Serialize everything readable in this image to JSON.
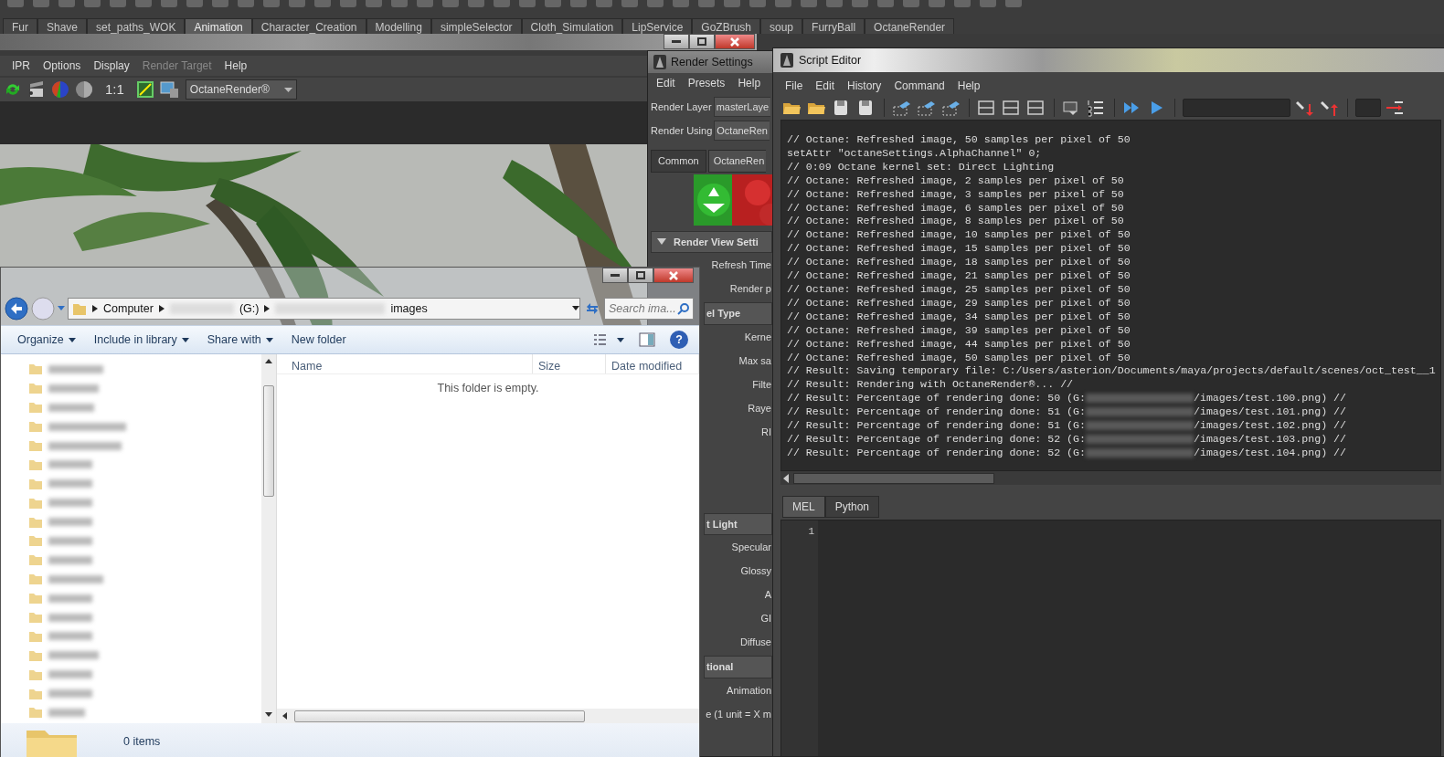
{
  "shelf_tabs": [
    {
      "label": "Fur",
      "selected": false
    },
    {
      "label": "Shave",
      "selected": false
    },
    {
      "label": "set_paths_WOK",
      "selected": false
    },
    {
      "label": "Animation",
      "selected": true
    },
    {
      "label": "Character_Creation",
      "selected": false
    },
    {
      "label": "Modelling",
      "selected": false
    },
    {
      "label": "simpleSelector",
      "selected": false
    },
    {
      "label": "Cloth_Simulation",
      "selected": false
    },
    {
      "label": "LipService",
      "selected": false
    },
    {
      "label": "GoZBrush",
      "selected": false
    },
    {
      "label": "soup",
      "selected": false
    },
    {
      "label": "FurryBall",
      "selected": false
    },
    {
      "label": "OctaneRender",
      "selected": false
    }
  ],
  "render_view": {
    "menu": [
      {
        "label": "IPR",
        "disabled": false
      },
      {
        "label": "Options",
        "disabled": false
      },
      {
        "label": "Display",
        "disabled": false
      },
      {
        "label": "Render Target",
        "disabled": true
      },
      {
        "label": "Help",
        "disabled": false
      }
    ],
    "ratio": "1:1",
    "renderer": "OctaneRender®"
  },
  "render_settings": {
    "title": "Render Settings",
    "menu": [
      "Edit",
      "Presets",
      "Help"
    ],
    "fields": [
      {
        "label": "Render Layer",
        "value": "masterLaye"
      },
      {
        "label": "Render Using",
        "value": "OctaneRen"
      }
    ],
    "tabs": [
      {
        "label": "Common",
        "selected": false
      },
      {
        "label": "OctaneRen",
        "selected": true
      }
    ],
    "sections": [
      {
        "title": "Render View Setti",
        "expanded": true,
        "rows": [
          "Refresh Time",
          "Render p"
        ]
      },
      {
        "title": "el Type",
        "rows": [
          "Kerne",
          "Max sa",
          "Filte",
          "Raye",
          "RI"
        ]
      },
      {
        "title": "t Light",
        "rows": [
          "Specular",
          "Glossy",
          "A",
          "GI",
          "Diffuse"
        ]
      },
      {
        "title": "tional",
        "rows": [
          "Animation",
          "e (1 unit = X m"
        ]
      }
    ]
  },
  "script_editor": {
    "title": "Script Editor",
    "menu": [
      "File",
      "Edit",
      "History",
      "Command",
      "Help"
    ],
    "history": [
      {
        "kind": "plain",
        "text": "// Octane: Refreshed image, 50 samples per pixel of 50"
      },
      {
        "kind": "plain",
        "text": "setAttr \"octaneSettings.AlphaChannel\" 0;"
      },
      {
        "kind": "plain",
        "text": "// 0:09 Octane kernel set: Direct Lighting"
      },
      {
        "kind": "plain",
        "text": "// Octane: Refreshed image, 2 samples per pixel of 50"
      },
      {
        "kind": "plain",
        "text": "// Octane: Refreshed image, 3 samples per pixel of 50"
      },
      {
        "kind": "plain",
        "text": "// Octane: Refreshed image, 6 samples per pixel of 50"
      },
      {
        "kind": "plain",
        "text": "// Octane: Refreshed image, 8 samples per pixel of 50"
      },
      {
        "kind": "plain",
        "text": "// Octane: Refreshed image, 10 samples per pixel of 50"
      },
      {
        "kind": "plain",
        "text": "// Octane: Refreshed image, 15 samples per pixel of 50"
      },
      {
        "kind": "plain",
        "text": "// Octane: Refreshed image, 18 samples per pixel of 50"
      },
      {
        "kind": "plain",
        "text": "// Octane: Refreshed image, 21 samples per pixel of 50"
      },
      {
        "kind": "plain",
        "text": "// Octane: Refreshed image, 25 samples per pixel of 50"
      },
      {
        "kind": "plain",
        "text": "// Octane: Refreshed image, 29 samples per pixel of 50"
      },
      {
        "kind": "plain",
        "text": "// Octane: Refreshed image, 34 samples per pixel of 50"
      },
      {
        "kind": "plain",
        "text": "// Octane: Refreshed image, 39 samples per pixel of 50"
      },
      {
        "kind": "plain",
        "text": "// Octane: Refreshed image, 44 samples per pixel of 50"
      },
      {
        "kind": "plain",
        "text": "// Octane: Refreshed image, 50 samples per pixel of 50"
      },
      {
        "kind": "plain",
        "text": "// Result: Saving temporary file: C:/Users/asterion/Documents/maya/projects/default/scenes/oct_test__1"
      },
      {
        "kind": "plain",
        "text": "// Result: Rendering with OctaneRender®... //"
      },
      {
        "kind": "redacted",
        "before": "// Result: Percentage of rendering done: 50 (G:",
        "after": "/images/test.100.png) //"
      },
      {
        "kind": "redacted",
        "before": "// Result: Percentage of rendering done: 51 (G:",
        "after": "/images/test.101.png) //"
      },
      {
        "kind": "redacted",
        "before": "// Result: Percentage of rendering done: 51 (G:",
        "after": "/images/test.102.png) //"
      },
      {
        "kind": "redacted",
        "before": "// Result: Percentage of rendering done: 52 (G:",
        "after": "/images/test.103.png) //"
      },
      {
        "kind": "redacted",
        "before": "// Result: Percentage of rendering done: 52 (G:",
        "after": "/images/test.104.png) //"
      }
    ],
    "input_tabs": [
      {
        "label": "MEL",
        "selected": true
      },
      {
        "label": "Python",
        "selected": false
      }
    ],
    "line_numbers": [
      "1"
    ]
  },
  "explorer": {
    "crumbs": [
      {
        "kind": "plain",
        "label": "Computer"
      },
      {
        "kind": "redacted",
        "label": "(G:)"
      },
      {
        "kind": "redacted_after",
        "label": "images"
      }
    ],
    "search": {
      "placeholder": "Search ima..."
    },
    "toolbar": [
      {
        "label": "Organize",
        "dropdown": true
      },
      {
        "label": "Include in library",
        "dropdown": true
      },
      {
        "label": "Share with",
        "dropdown": true
      },
      {
        "label": "New folder",
        "dropdown": false
      }
    ],
    "help": "?",
    "columns": [
      "Name",
      "Size",
      "Date modified"
    ],
    "empty_message": "This folder is empty.",
    "status": "0 items"
  }
}
